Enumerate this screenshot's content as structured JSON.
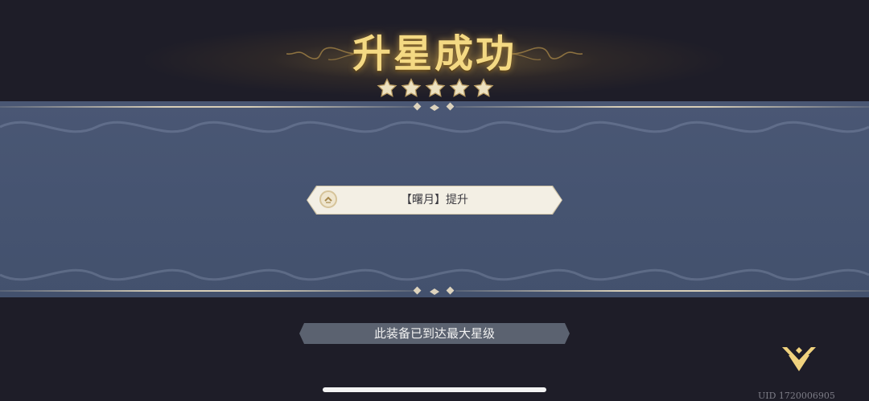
{
  "header": {
    "title": "升星成功",
    "star_count": 5,
    "star_color": "#e9dcb7"
  },
  "banner": {
    "background_color": "#47546f",
    "upgrade_text": "【曙月】提升",
    "upgrade_icon": "chevron-up-icon"
  },
  "footer": {
    "max_star_text": "此装备已到达最大星级",
    "next_icon": "chevron-down-icon",
    "accent_color": "#f0d27e",
    "uid_text": "UID 1720006905"
  }
}
